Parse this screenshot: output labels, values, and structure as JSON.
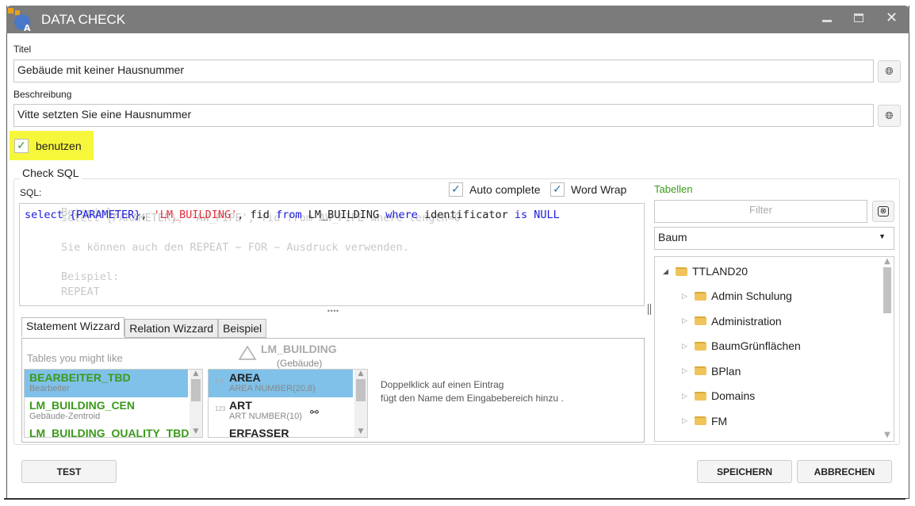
{
  "window": {
    "title": "DATA CHECK"
  },
  "form": {
    "title_label": "Titel",
    "title_value": "Gebäude mit keiner Hausnummer",
    "description_label": "Beschreibung",
    "description_value": "Vitte setzten Sie eine Hausnummer",
    "use_label": "benutzen",
    "use_checked": true
  },
  "sql": {
    "group_label": "Check SQL",
    "sql_label": "SQL:",
    "auto_complete_label": "Auto complete",
    "auto_complete_checked": true,
    "word_wrap_label": "Word Wrap",
    "word_wrap_checked": true,
    "code": {
      "kw1": "select",
      "param": "{PARAMETER}",
      "comma1": ",",
      "str": "'LM_BUILDING'",
      "mid": ", fid",
      "kw2": "from",
      "table": "LM_BUILDING",
      "kw3": "where",
      "col": "identificator",
      "kw4": "is",
      "kw5": "NULL"
    },
    "placeholder_lines": [
      "Beispiel:",
      "select {PARAMETER}, 'AW_PIPE', fid from AW_PIPE where length=0",
      "",
      "Sie können auch den REPEAT ~ FOR ~ Ausdruck verwenden.",
      "",
      "Beispiel:",
      "REPEAT"
    ]
  },
  "tabs": [
    {
      "label": "Statement Wizzard",
      "active": true
    },
    {
      "label": "Relation Wizzard"
    },
    {
      "label": "Beispiel"
    }
  ],
  "wizard": {
    "tables_label": "Tables you might like",
    "tables": [
      {
        "name": "BEARBEITER_TBD",
        "sub": "Bearbeiter",
        "selected": true
      },
      {
        "name": "LM_BUILDING_CEN",
        "sub": "Gebäude-Zentroid"
      },
      {
        "name": "LM_BUILDING_QUALITY_TBD",
        "sub": ""
      }
    ],
    "current_table": "LM_BUILDING",
    "current_table_sub": "(Gebäude)",
    "columns": [
      {
        "type": "1.5",
        "name": "AREA",
        "sub": "AREA NUMBER(20,8)",
        "selected": true
      },
      {
        "type": "123",
        "name": "ART",
        "sub": "ART NUMBER(10)",
        "link": true
      },
      {
        "type": "",
        "name": "ERFASSER",
        "sub": ""
      }
    ],
    "hint_line1": "Doppelklick auf einen Eintrag",
    "hint_line2": "fügt den Name dem Eingabebereich hinzu ."
  },
  "tables_panel": {
    "label": "Tabellen",
    "filter_placeholder": "Filter",
    "view_select": "Baum",
    "tree_root": "TTLAND20",
    "tree_items": [
      "Admin Schulung",
      "Administration",
      "BaumGrünflächen",
      "BPlan",
      "Domains",
      "FM"
    ]
  },
  "buttons": {
    "test": "TEST",
    "save": "SPEICHERN",
    "cancel": "ABBRECHEN"
  },
  "colors": {
    "accent_green": "#3a9a1a",
    "highlight": "#f6f63a",
    "selection": "#7fc1e8",
    "keyword": "#1a1adf",
    "string": "#e0303a"
  }
}
